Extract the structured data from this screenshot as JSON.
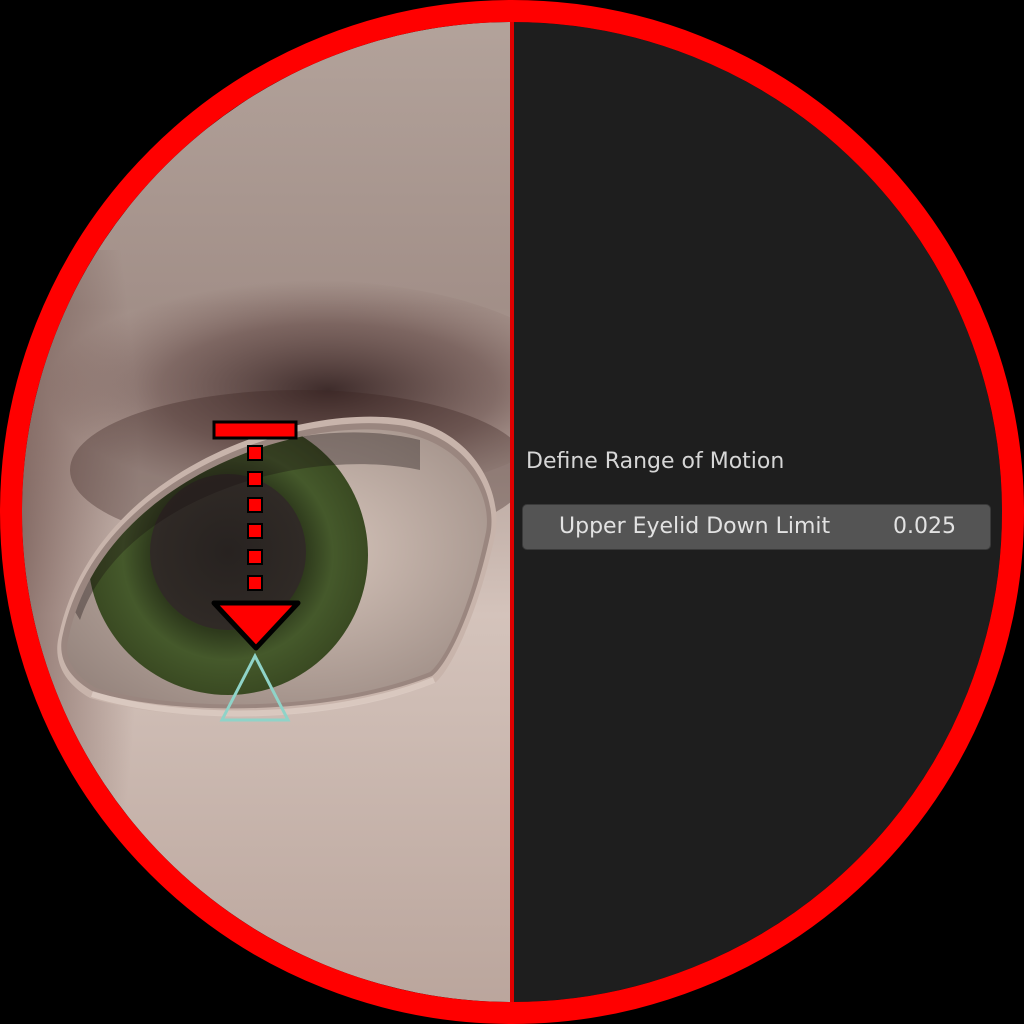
{
  "panel": {
    "title": "Define Range of Motion",
    "property": {
      "label": "Upper Eyelid Down Limit",
      "value": "0.025"
    }
  },
  "viewport": {
    "subject": "eye-closeup",
    "iris_color": "#3f5026",
    "indicator_color": "#ff0000",
    "target_marker_color": "#8fd3c8"
  },
  "colors": {
    "frame_ring": "#ff0000",
    "panel_background": "#1e1e1e",
    "field_background": "#545454",
    "text": "#d6d6d6"
  }
}
